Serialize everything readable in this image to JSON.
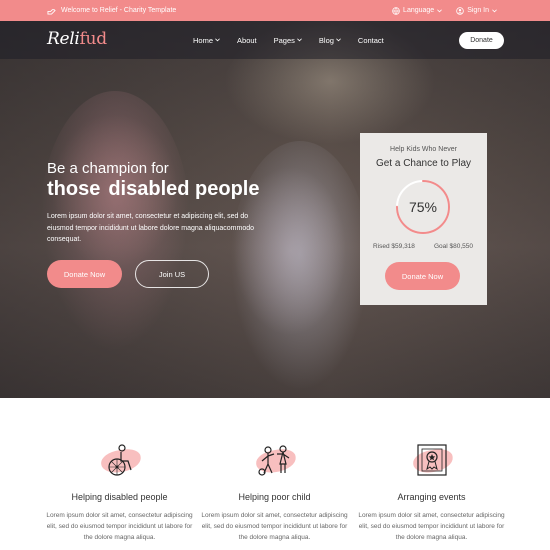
{
  "topbar": {
    "welcome": "Welcome to Relief - Charity Template",
    "language": "Language",
    "signin": "Sign In"
  },
  "nav": {
    "logo_main": "Reli",
    "logo_accent": "fud",
    "items": [
      {
        "label": "Home",
        "dropdown": true
      },
      {
        "label": "About",
        "dropdown": false
      },
      {
        "label": "Pages",
        "dropdown": true
      },
      {
        "label": "Blog",
        "dropdown": true
      },
      {
        "label": "Contact",
        "dropdown": false
      }
    ],
    "donate": "Donate"
  },
  "hero": {
    "line1": "Be a champion for",
    "line2_a": "those",
    "line2_b": "disabled people",
    "desc": "Lorem ipsum dolor sit amet, consectetur et adipiscing elit, sed do eiusmod tempor incididunt ut labore dolore magna aliquacommodo consequat.",
    "donate_btn": "Donate Now",
    "join_btn": "Join US"
  },
  "card": {
    "subtitle": "Help Kids Who Never",
    "title": "Get a Chance to Play",
    "progress_label": "75%",
    "progress": 0.75,
    "raised": "Rised $59,318",
    "goal": "Goal $80,550",
    "button": "Donate Now"
  },
  "features": [
    {
      "icon": "wheelchair-icon",
      "title": "Helping disabled people",
      "text": "Lorem ipsum dolor sit amet, consectetur adipiscing elit, sed do eiusmod tempor incididunt ut labore for the dolore magna aliqua."
    },
    {
      "icon": "children-icon",
      "title": "Helping poor child",
      "text": "Lorem ipsum dolor sit amet, consectetur adipiscing elit, sed do eiusmod tempor incididunt ut labore for the dolore magna aliqua."
    },
    {
      "icon": "certificate-icon",
      "title": "Arranging events",
      "text": "Lorem ipsum dolor sit amet, consectetur adipiscing elit, sed do eiusmod tempor incididunt ut labore for the dolore magna aliqua."
    }
  ],
  "colors": {
    "accent": "#f28b8b",
    "card_bg": "#ebe9e7"
  }
}
